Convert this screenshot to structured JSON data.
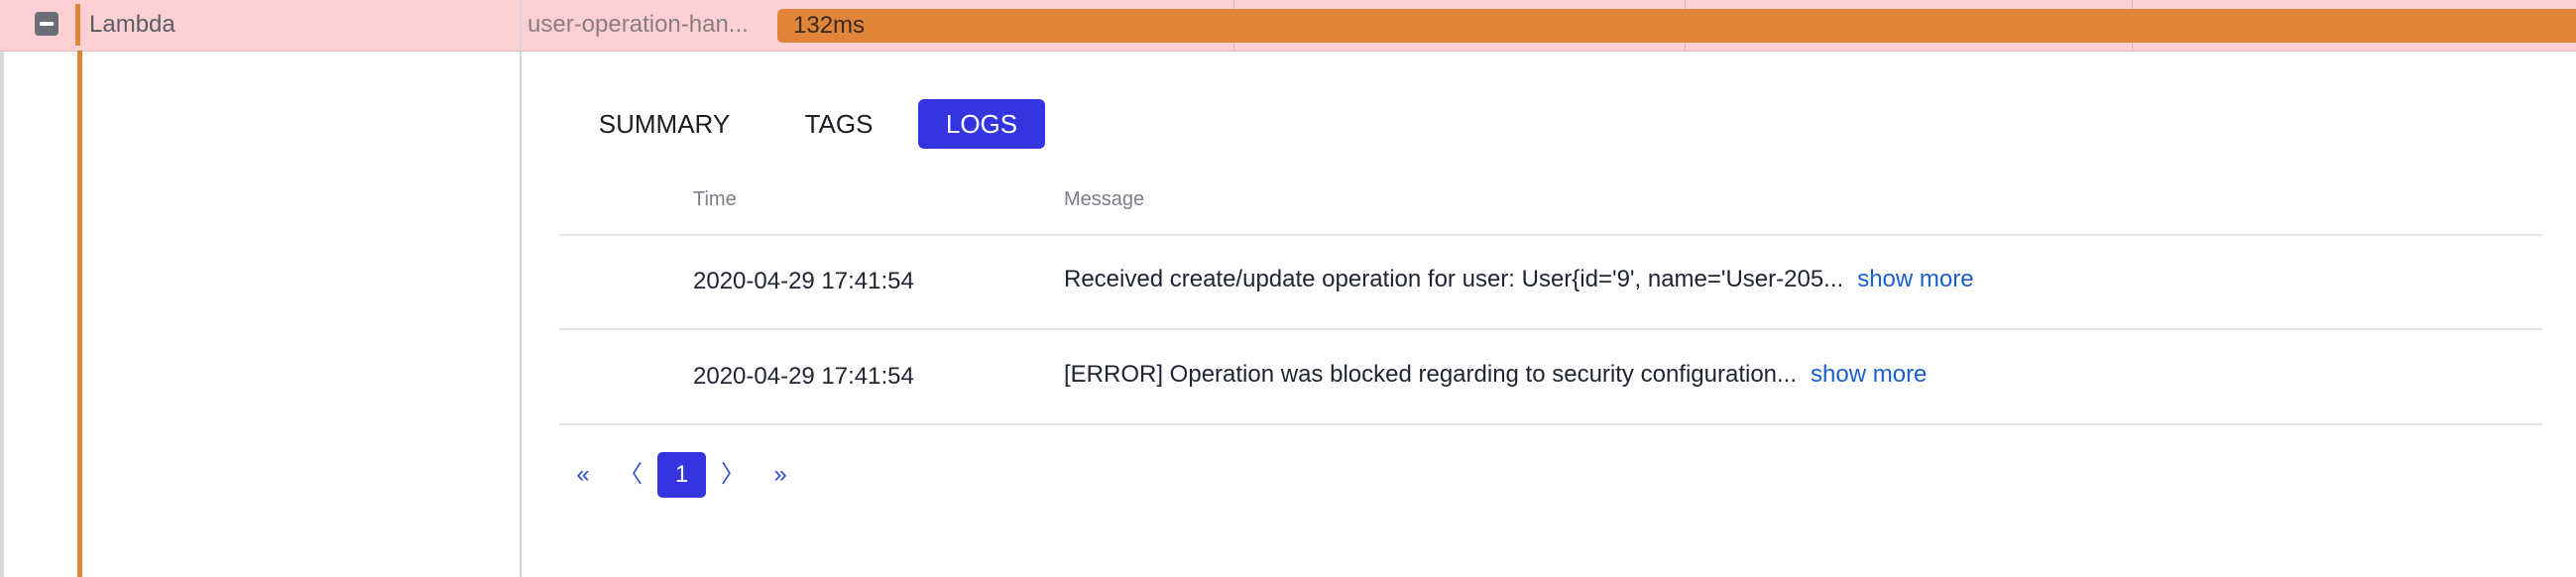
{
  "span": {
    "service_name": "Lambda",
    "operation_name": "user-operation-han...",
    "duration": "132ms"
  },
  "tabs": [
    {
      "label": "SUMMARY",
      "active": false
    },
    {
      "label": "TAGS",
      "active": false
    },
    {
      "label": "LOGS",
      "active": true
    }
  ],
  "logs": {
    "columns": [
      "Time",
      "Message"
    ],
    "rows": [
      {
        "time": "2020-04-29 17:41:54",
        "message": "Received create/update operation for user: User{id='9', name='User-205...",
        "more": "show more"
      },
      {
        "time": "2020-04-29 17:41:54",
        "message": "[ERROR] Operation was blocked regarding to security configuration...",
        "more": "show more"
      }
    ]
  },
  "pagination": {
    "first": "«",
    "prev": "〈",
    "current": "1",
    "next": "〉",
    "last": "»"
  },
  "colors": {
    "span_row_bg": "#fdd0d3",
    "duration_bar": "#e0843a",
    "accent": "#3535e0",
    "link": "#1a5fd1"
  }
}
